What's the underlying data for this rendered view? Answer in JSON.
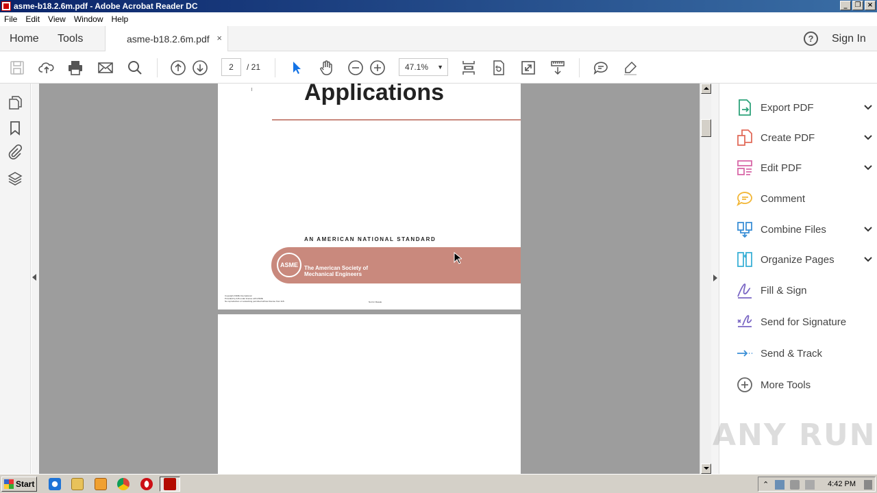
{
  "window": {
    "title": "asme-b18.2.6m.pdf - Adobe Acrobat Reader DC"
  },
  "menu": [
    "File",
    "Edit",
    "View",
    "Window",
    "Help"
  ],
  "tabs": {
    "home": "Home",
    "tools": "Tools",
    "document": "asme-b18.2.6m.pdf",
    "close": "×"
  },
  "header": {
    "sign_in": "Sign In",
    "help": "?"
  },
  "toolbar": {
    "page_current": "2",
    "page_total": "/ 21",
    "zoom": "47.1%",
    "icons": [
      "save-icon",
      "upload-cloud-icon",
      "print-icon",
      "email-icon",
      "search-icon",
      "prev-page-icon",
      "next-page-icon",
      "select-cursor-icon",
      "hand-icon",
      "zoom-out-icon",
      "zoom-in-icon",
      "fit-page-icon",
      "rotate-icon",
      "full-screen-icon",
      "scroll-mode-icon",
      "comment-icon",
      "highlight-pen-icon"
    ]
  },
  "left_rail": [
    "pages-icon",
    "bookmark-icon",
    "attachment-icon",
    "layers-icon"
  ],
  "document": {
    "title": "Applications",
    "standard_line": "AN AMERICAN NATIONAL STANDARD",
    "seal": "ASME",
    "org_line1": "The American Society of",
    "org_line2": "Mechanical Engineers",
    "fine_print1": "Copyright ASME International",
    "fine_print2": "Provided by IHS under license with ASME",
    "fine_print3": "No reproduction or networking permitted without license from IHS",
    "fine_print4": "Not for Resale"
  },
  "tools_pane": [
    {
      "label": "Export PDF",
      "icon": "export-pdf-icon",
      "color": "#2da27a",
      "expandable": true
    },
    {
      "label": "Create PDF",
      "icon": "create-pdf-icon",
      "color": "#e26b5a",
      "expandable": true
    },
    {
      "label": "Edit PDF",
      "icon": "edit-pdf-icon",
      "color": "#d868a8",
      "expandable": true
    },
    {
      "label": "Comment",
      "icon": "comment-icon",
      "color": "#f2b636",
      "expandable": false
    },
    {
      "label": "Combine Files",
      "icon": "combine-files-icon",
      "color": "#3a8fd6",
      "expandable": true
    },
    {
      "label": "Organize Pages",
      "icon": "organize-pages-icon",
      "color": "#3ab0d6",
      "expandable": true
    },
    {
      "label": "Fill & Sign",
      "icon": "fill-sign-icon",
      "color": "#7a66c4",
      "expandable": false
    },
    {
      "label": "Send for Signature",
      "icon": "send-signature-icon",
      "color": "#7a66c4",
      "expandable": false
    },
    {
      "label": "Send & Track",
      "icon": "send-track-icon",
      "color": "#3a8fd6",
      "expandable": false
    },
    {
      "label": "More Tools",
      "icon": "more-tools-icon",
      "color": "#666666",
      "expandable": false
    }
  ],
  "watermark": "ANY RUN",
  "taskbar": {
    "start": "Start",
    "clock": "4:42 PM"
  }
}
